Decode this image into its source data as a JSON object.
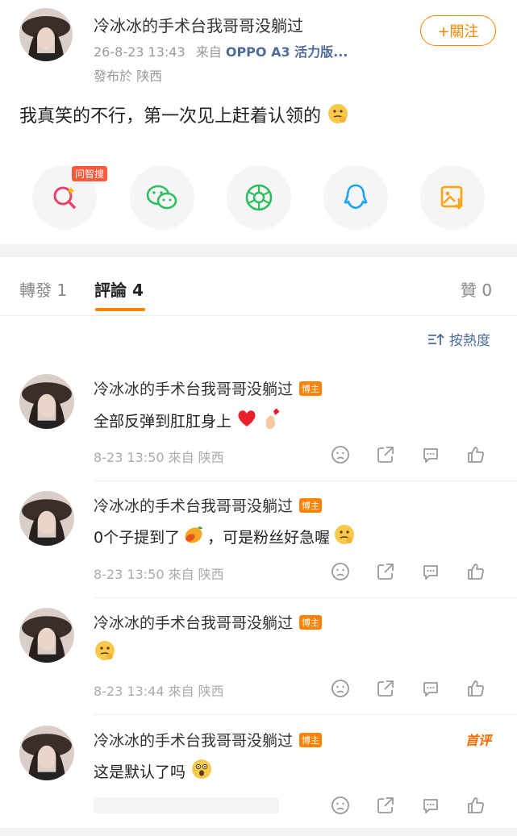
{
  "post": {
    "author": "冷冰冰的手术台我哥哥没躺过",
    "time": "26-8-23 13:43",
    "source_prefix": "来自",
    "source": "OPPO A3 活力版...",
    "location": "發布於 陕西",
    "follow_label": "+關注",
    "text": "我真笑的不行，第一次见上赶着认领的"
  },
  "share": {
    "search_tag": "问智搜",
    "buttons": [
      "search-icon",
      "wechat-icon",
      "moments-icon",
      "qq-icon",
      "save-image-icon"
    ]
  },
  "tabs": {
    "repost": "轉發 1",
    "comments": "評論 4",
    "likes": "贊 0"
  },
  "sort_label": "按熱度",
  "comments": [
    {
      "author": "冷冰冰的手术台我哥哥没躺过",
      "badge": "博主",
      "text": "全部反弹到肛肛身上",
      "emojis": [
        "heart",
        "finger-heart"
      ],
      "meta": "8-23 13:50 來自 陕西",
      "first": ""
    },
    {
      "author": "冷冰冰的手术台我哥哥没躺过",
      "badge": "博主",
      "text": "0个子提到了",
      "emojis": [
        "mango"
      ],
      "text2": "，可是粉丝好急喔",
      "emojis2": [
        "thinking"
      ],
      "meta": "8-23 13:50 來自 陕西",
      "first": ""
    },
    {
      "author": "冷冰冰的手术台我哥哥没躺过",
      "badge": "博主",
      "text": "",
      "emojis": [
        "thinking"
      ],
      "meta": "8-23 13:44 來自 陕西",
      "first": ""
    },
    {
      "author": "冷冰冰的手术台我哥哥没躺过",
      "badge": "博主",
      "text": "这是默认了吗",
      "emojis": [
        "shocked"
      ],
      "meta": "",
      "first": "首评"
    }
  ]
}
